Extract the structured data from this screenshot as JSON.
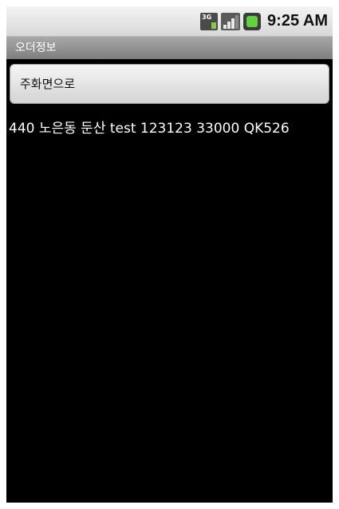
{
  "status_bar": {
    "network_label": "3G",
    "time": "9:25 AM",
    "icons": [
      "3g-data-icon",
      "signal-icon",
      "battery-icon"
    ]
  },
  "title_bar": {
    "title": "오더정보"
  },
  "main": {
    "home_button_label": "주화면으로",
    "order_info": "440 노은동 둔산 test 123123 33000 QK526"
  },
  "colors": {
    "background": "#000000",
    "title_bar": "#8e8e8e",
    "text": "#ffffff"
  }
}
